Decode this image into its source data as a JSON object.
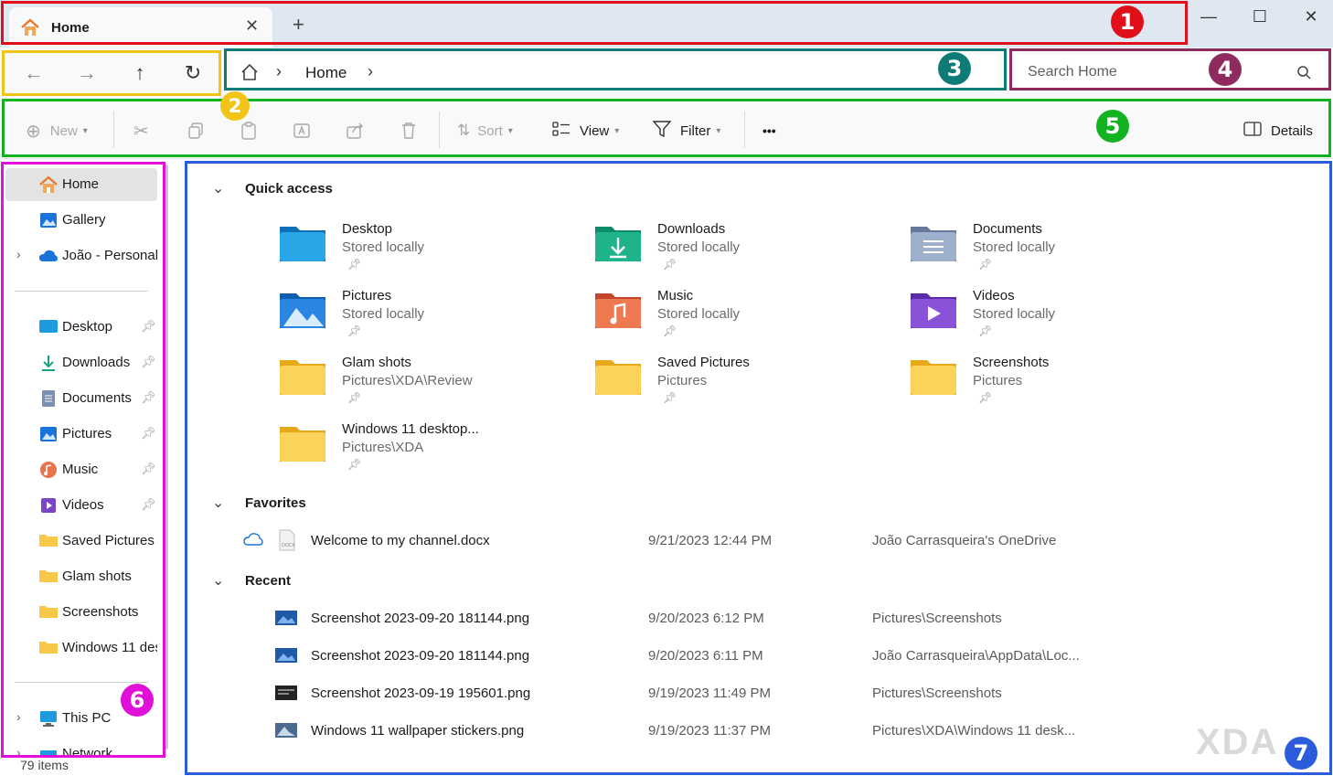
{
  "window": {
    "tab_title": "Home",
    "new_tab_symbol": "+",
    "minimize_symbol": "—",
    "maximize_symbol": "☐",
    "close_symbol": "✕"
  },
  "navigation": {
    "back_icon": "arrow-left-icon",
    "forward_icon": "arrow-right-icon",
    "up_icon": "arrow-up-icon",
    "refresh_icon": "refresh-icon"
  },
  "address_bar": {
    "path": [
      "Home"
    ]
  },
  "search": {
    "placeholder": "Search Home"
  },
  "command_bar": {
    "new_label": "New",
    "sort_label": "Sort",
    "view_label": "View",
    "filter_label": "Filter",
    "more_label": "•••",
    "details_label": "Details"
  },
  "sidebar": {
    "top_items": [
      {
        "label": "Home"
      },
      {
        "label": "Gallery"
      },
      {
        "label": "João - Personal"
      }
    ],
    "pinned_items": [
      {
        "label": "Desktop"
      },
      {
        "label": "Downloads"
      },
      {
        "label": "Documents"
      },
      {
        "label": "Pictures"
      },
      {
        "label": "Music"
      },
      {
        "label": "Videos"
      },
      {
        "label": "Saved Pictures"
      },
      {
        "label": "Glam shots"
      },
      {
        "label": "Screenshots"
      },
      {
        "label": "Windows 11 des"
      }
    ],
    "bottom_items": [
      {
        "label": "This PC"
      },
      {
        "label": "Network"
      }
    ]
  },
  "status_bar": {
    "item_count": "79 items"
  },
  "quick_access": {
    "title": "Quick access",
    "items": [
      {
        "name": "Desktop",
        "location": "Stored locally"
      },
      {
        "name": "Downloads",
        "location": "Stored locally"
      },
      {
        "name": "Documents",
        "location": "Stored locally"
      },
      {
        "name": "Pictures",
        "location": "Stored locally"
      },
      {
        "name": "Music",
        "location": "Stored locally"
      },
      {
        "name": "Videos",
        "location": "Stored locally"
      },
      {
        "name": "Glam shots",
        "location": "Pictures\\XDA\\Review"
      },
      {
        "name": "Saved Pictures",
        "location": "Pictures"
      },
      {
        "name": "Screenshots",
        "location": "Pictures"
      },
      {
        "name": "Windows 11 desktop...",
        "location": "Pictures\\XDA"
      }
    ]
  },
  "favorites": {
    "title": "Favorites",
    "files": [
      {
        "name": "Welcome to my channel.docx",
        "date": "9/21/2023 12:44 PM",
        "location": "João Carrasqueira's OneDrive"
      }
    ]
  },
  "recent": {
    "title": "Recent",
    "files": [
      {
        "name": "Screenshot 2023-09-20 181144.png",
        "date": "9/20/2023 6:12 PM",
        "location": "Pictures\\Screenshots"
      },
      {
        "name": "Screenshot 2023-09-20 181144.png",
        "date": "9/20/2023 6:11 PM",
        "location": "João Carrasqueira\\AppData\\Loc..."
      },
      {
        "name": "Screenshot 2023-09-19 195601.png",
        "date": "9/19/2023 11:49 PM",
        "location": "Pictures\\Screenshots"
      },
      {
        "name": "Windows 11 wallpaper stickers.png",
        "date": "9/19/2023 11:37 PM",
        "location": "Pictures\\XDA\\Windows 11 desk..."
      }
    ]
  },
  "annotations": [
    {
      "number": "1",
      "color": "#e0101a"
    },
    {
      "number": "2",
      "color": "#f3c418"
    },
    {
      "number": "3",
      "color": "#0f7b76"
    },
    {
      "number": "4",
      "color": "#8e2a5e"
    },
    {
      "number": "5",
      "color": "#13b220"
    },
    {
      "number": "6",
      "color": "#e010d8"
    },
    {
      "number": "7",
      "color": "#2b5cdc"
    }
  ],
  "watermark": "XDA"
}
